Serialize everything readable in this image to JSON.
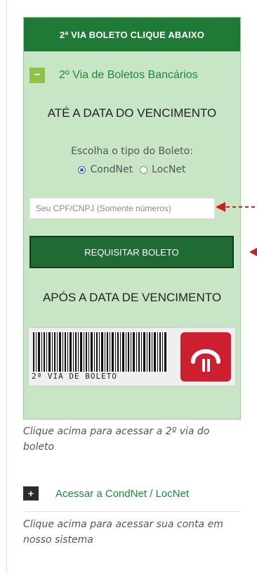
{
  "widget": {
    "header": "2ª VIA BOLETO CLIQUE ABAIXO",
    "accordion_icon": "minus-icon",
    "accordion_title": "2º Via de Boletos Bancários",
    "ate_text": "ATÉ A DATA DO VENCIMENTO",
    "escolha_text": "Escolha o tipo do Boleto:",
    "radio_options": [
      {
        "label": "CondNet",
        "selected": true
      },
      {
        "label": "LocNet",
        "selected": false
      }
    ],
    "cpf_placeholder": "Seu CPF/CNPJ (Somente números)",
    "button_label": "REQUISITAR BOLETO",
    "apos_text": "APÓS A DATA DE VENCIMENTO",
    "barcode_caption": "2ª VIA DE BOLETO",
    "logo_icon": "bank-logo-icon"
  },
  "caption1": "Clique acima para acessar a 2º via do boleto",
  "accordion2": {
    "icon": "plus-icon",
    "title": "Acessar a CondNet / LocNet"
  },
  "caption2": "Clique acima para acessar sua conta em nosso sistema",
  "colors": {
    "header_green": "#1f7a35",
    "panel_green": "#c8e6c6",
    "accent_green": "#1f8a3d",
    "arrow_red": "#cc1f1f",
    "logo_red": "#cc1f2f"
  }
}
